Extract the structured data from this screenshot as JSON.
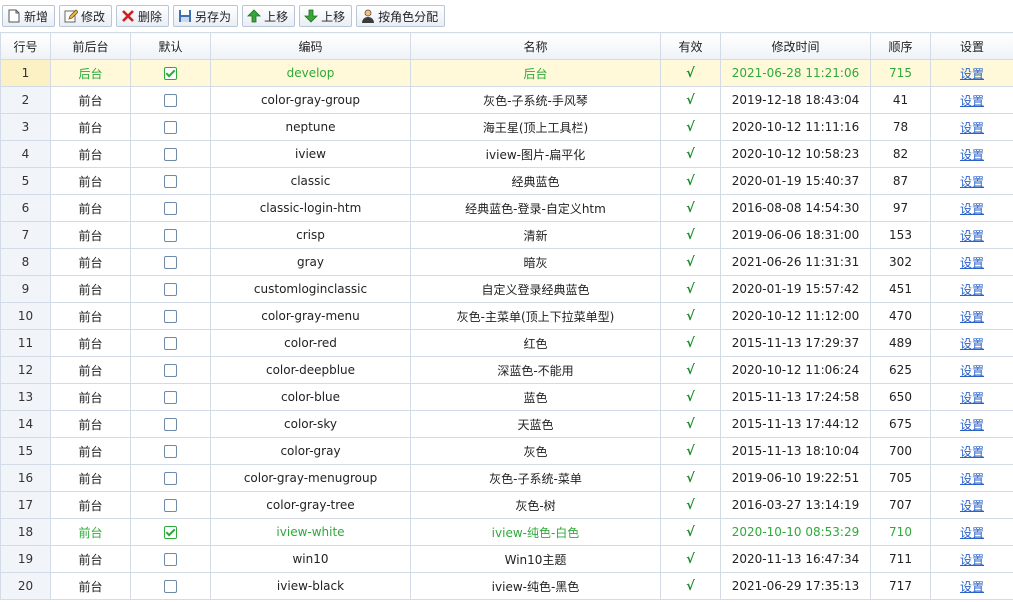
{
  "toolbar": {
    "add": "新增",
    "edit": "修改",
    "delete": "删除",
    "save_as": "另存为",
    "move_up_1": "上移",
    "move_up_2": "上移",
    "assign_by_role": "按角色分配"
  },
  "columns": [
    "行号",
    "前后台",
    "默认",
    "编码",
    "名称",
    "有效",
    "修改时间",
    "顺序",
    "设置"
  ],
  "valid_mark": "√",
  "set_label": "设置",
  "rows": [
    {
      "num": "1",
      "side": "后台",
      "default": true,
      "code": "develop",
      "name": "后台",
      "time": "2021-06-28 11:21:06",
      "order": "715"
    },
    {
      "num": "2",
      "side": "前台",
      "default": false,
      "code": "color-gray-group",
      "name": "灰色-子系统-手风琴",
      "time": "2019-12-18 18:43:04",
      "order": "41"
    },
    {
      "num": "3",
      "side": "前台",
      "default": false,
      "code": "neptune",
      "name": "海王星(顶上工具栏)",
      "time": "2020-10-12 11:11:16",
      "order": "78"
    },
    {
      "num": "4",
      "side": "前台",
      "default": false,
      "code": "iview",
      "name": "iview-图片-扁平化",
      "time": "2020-10-12 10:58:23",
      "order": "82"
    },
    {
      "num": "5",
      "side": "前台",
      "default": false,
      "code": "classic",
      "name": "经典蓝色",
      "time": "2020-01-19 15:40:37",
      "order": "87"
    },
    {
      "num": "6",
      "side": "前台",
      "default": false,
      "code": "classic-login-htm",
      "name": "经典蓝色-登录-自定义htm",
      "time": "2016-08-08 14:54:30",
      "order": "97"
    },
    {
      "num": "7",
      "side": "前台",
      "default": false,
      "code": "crisp",
      "name": "清新",
      "time": "2019-06-06 18:31:00",
      "order": "153"
    },
    {
      "num": "8",
      "side": "前台",
      "default": false,
      "code": "gray",
      "name": "暗灰",
      "time": "2021-06-26 11:31:31",
      "order": "302"
    },
    {
      "num": "9",
      "side": "前台",
      "default": false,
      "code": "customloginclassic",
      "name": "自定义登录经典蓝色",
      "time": "2020-01-19 15:57:42",
      "order": "451"
    },
    {
      "num": "10",
      "side": "前台",
      "default": false,
      "code": "color-gray-menu",
      "name": "灰色-主菜单(顶上下拉菜单型)",
      "time": "2020-10-12 11:12:00",
      "order": "470"
    },
    {
      "num": "11",
      "side": "前台",
      "default": false,
      "code": "color-red",
      "name": "红色",
      "time": "2015-11-13 17:29:37",
      "order": "489"
    },
    {
      "num": "12",
      "side": "前台",
      "default": false,
      "code": "color-deepblue",
      "name": "深蓝色-不能用",
      "time": "2020-10-12 11:06:24",
      "order": "625"
    },
    {
      "num": "13",
      "side": "前台",
      "default": false,
      "code": "color-blue",
      "name": "蓝色",
      "time": "2015-11-13 17:24:58",
      "order": "650"
    },
    {
      "num": "14",
      "side": "前台",
      "default": false,
      "code": "color-sky",
      "name": "天蓝色",
      "time": "2015-11-13 17:44:12",
      "order": "675"
    },
    {
      "num": "15",
      "side": "前台",
      "default": false,
      "code": "color-gray",
      "name": "灰色",
      "time": "2015-11-13 18:10:04",
      "order": "700"
    },
    {
      "num": "16",
      "side": "前台",
      "default": false,
      "code": "color-gray-menugroup",
      "name": "灰色-子系统-菜单",
      "time": "2019-06-10 19:22:51",
      "order": "705"
    },
    {
      "num": "17",
      "side": "前台",
      "default": false,
      "code": "color-gray-tree",
      "name": "灰色-树",
      "time": "2016-03-27 13:14:19",
      "order": "707"
    },
    {
      "num": "18",
      "side": "前台",
      "default": true,
      "code": "iview-white",
      "name": "iview-纯色-白色",
      "time": "2020-10-10 08:53:29",
      "order": "710"
    },
    {
      "num": "19",
      "side": "前台",
      "default": false,
      "code": "win10",
      "name": "Win10主题",
      "time": "2020-11-13 16:47:34",
      "order": "711"
    },
    {
      "num": "20",
      "side": "前台",
      "default": false,
      "code": "iview-black",
      "name": "iview-纯色-黑色",
      "time": "2021-06-29 17:35:13",
      "order": "717"
    }
  ],
  "colors": {
    "accent_green": "#2eaa3a",
    "link_blue": "#2a62c9",
    "highlight_row": "#fff9d9",
    "border": "#d3dbe6"
  }
}
